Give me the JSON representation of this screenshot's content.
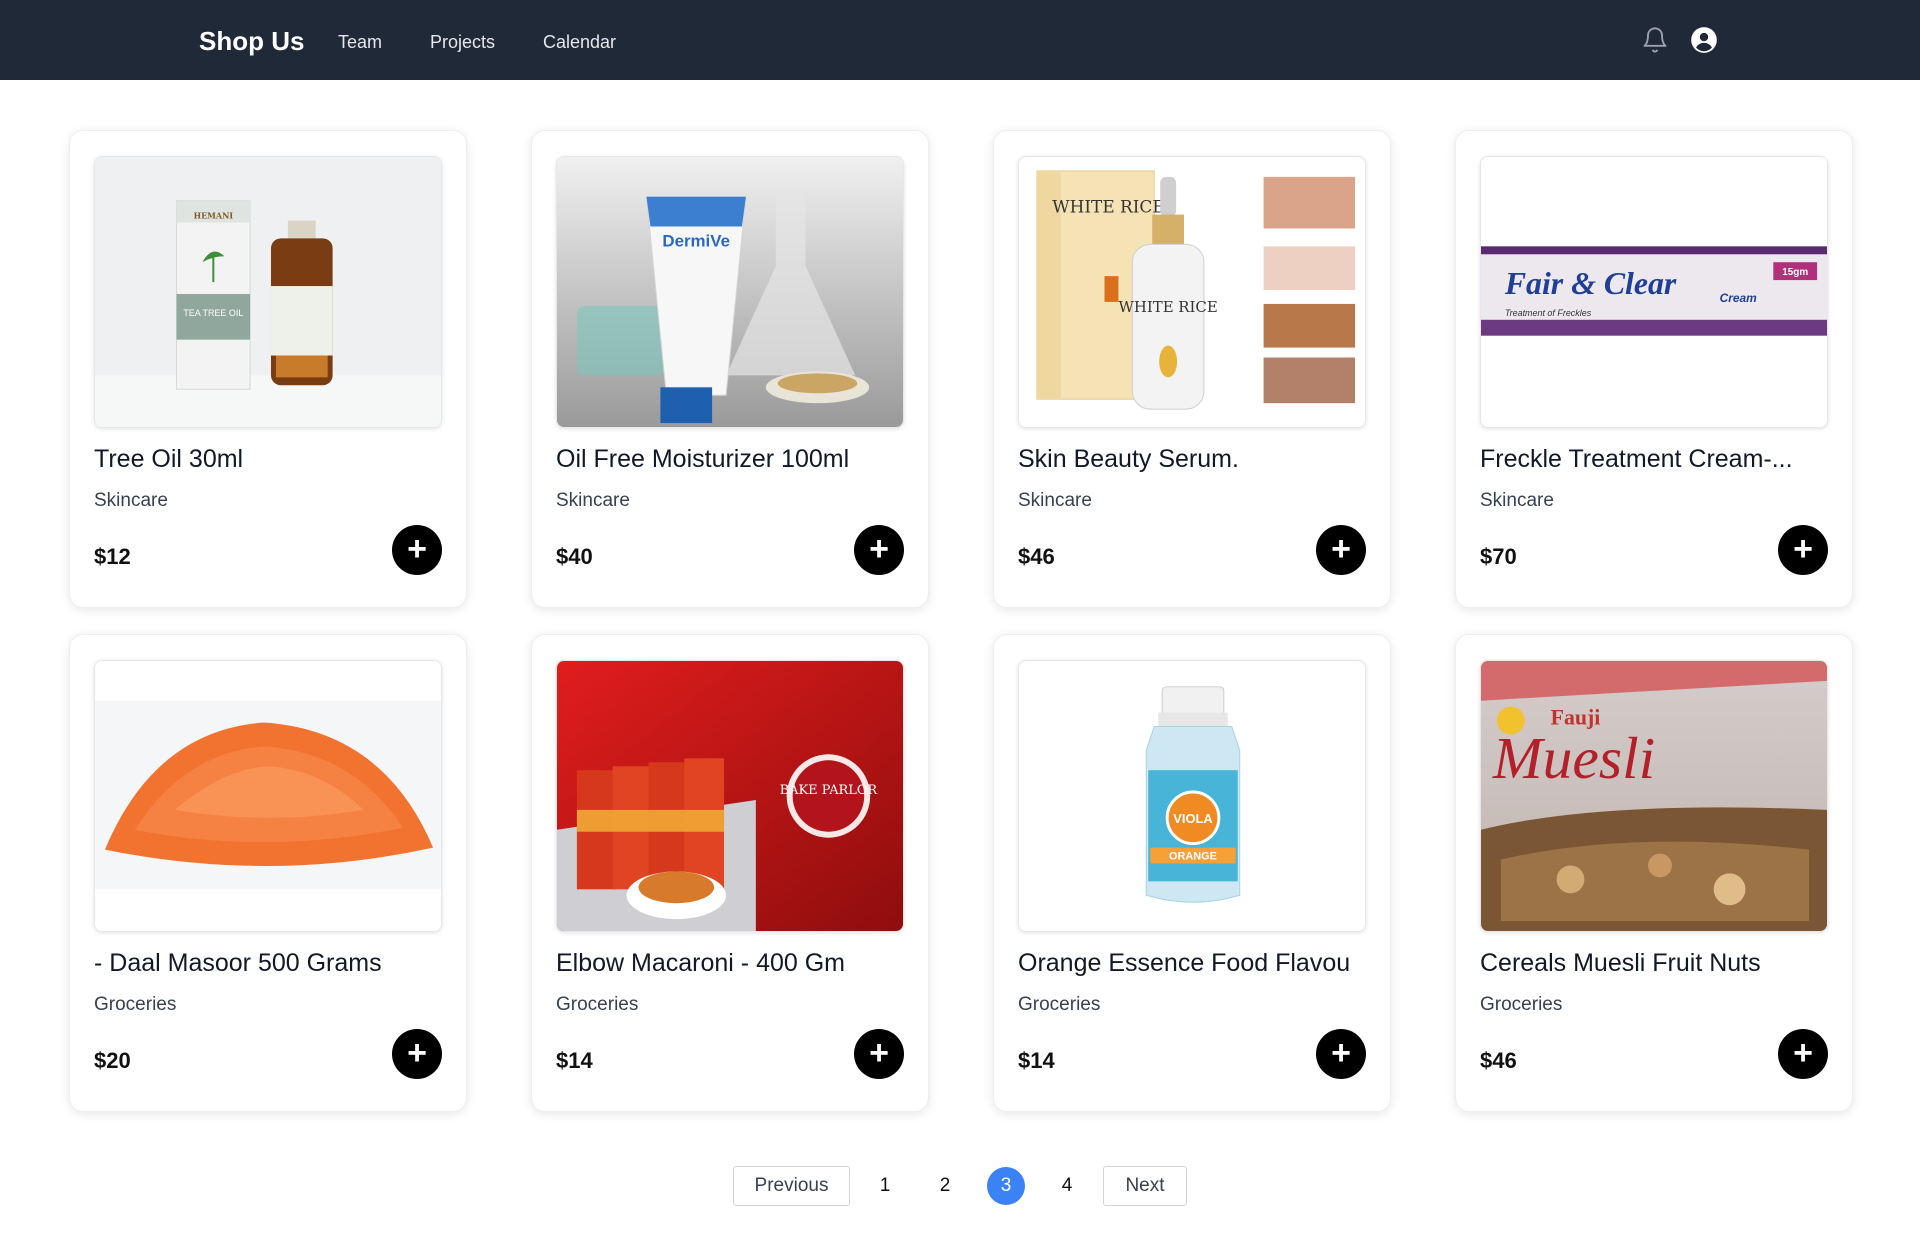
{
  "header": {
    "brand": "Shop Us",
    "nav": [
      "Team",
      "Projects",
      "Calendar"
    ],
    "icons": [
      "bell-icon",
      "user-circle-icon"
    ]
  },
  "products": [
    {
      "name": "Tree Oil 30ml",
      "category": "Skincare",
      "price": "$12"
    },
    {
      "name": "Oil Free Moisturizer 100ml",
      "category": "Skincare",
      "price": "$40"
    },
    {
      "name": "Skin Beauty Serum.",
      "category": "Skincare",
      "price": "$46"
    },
    {
      "name": "Freckle Treatment Cream-...",
      "category": "Skincare",
      "price": "$70"
    },
    {
      "name": "- Daal Masoor 500 Grams",
      "category": "Groceries",
      "price": "$20"
    },
    {
      "name": "Elbow Macaroni - 400 Gm",
      "category": "Groceries",
      "price": "$14"
    },
    {
      "name": "Orange Essence Food Flavou",
      "category": "Groceries",
      "price": "$14"
    },
    {
      "name": "Cereals Muesli Fruit Nuts",
      "category": "Groceries",
      "price": "$46"
    }
  ],
  "image_text": {
    "p1_brand": "HEMANI",
    "p1_label": "TEA TREE OIL",
    "p2_label": "DermiVe",
    "p3_label": "WHITE RICE",
    "p4_label": "Fair & Clear",
    "p4_sub": "Cream",
    "p4_weight": "15gm",
    "p4_caption": "Treatment of Freckles",
    "p6_label": "BAKE PARLOR",
    "p7_label": "VIOLA",
    "p7_sub": "ORANGE",
    "p8_brand": "Fauji",
    "p8_label": "Muesli"
  },
  "pagination": {
    "previous": "Previous",
    "next": "Next",
    "pages": [
      "1",
      "2",
      "3",
      "4"
    ],
    "current": "3"
  },
  "colors": {
    "navbar": "#1f2937",
    "active_page": "#3b82f6",
    "add_button": "#000000"
  }
}
